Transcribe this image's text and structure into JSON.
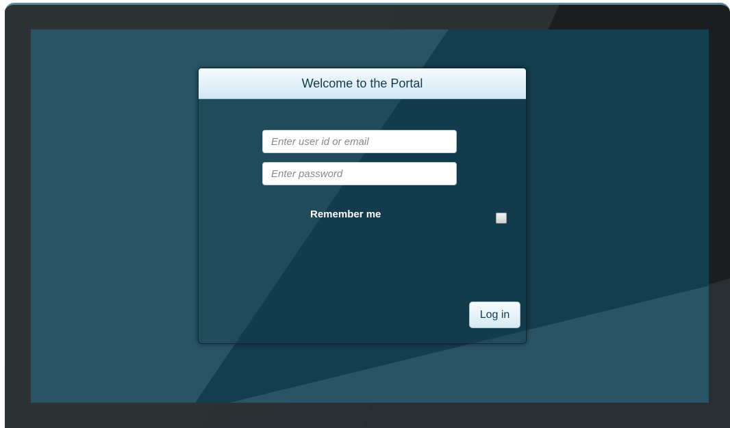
{
  "login": {
    "title": "Welcome to the Portal",
    "user_placeholder": "Enter user id or email",
    "password_placeholder": "Enter password",
    "user_value": "",
    "password_value": "",
    "remember_label": "Remember me",
    "remember_checked": false,
    "login_button": "Log in"
  },
  "colors": {
    "screen_background": "#143d4f",
    "header_text": "#123a4e",
    "bezel": "#1a1e20"
  }
}
